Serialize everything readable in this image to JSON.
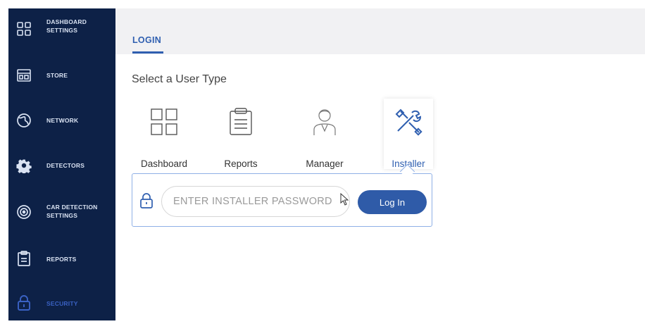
{
  "sidebar": {
    "items": [
      {
        "label": "DASHBOARD SETTINGS",
        "line1": "DASHBOARD",
        "line2": "SETTINGS",
        "icon": "dashboard-grid-icon"
      },
      {
        "label": "STORE",
        "icon": "store-icon"
      },
      {
        "label": "NETWORK",
        "icon": "globe-icon"
      },
      {
        "label": "DETECTORS",
        "icon": "gear-icon"
      },
      {
        "label": "CAR DETECTION SETTINGS",
        "line1": "CAR DETECTION",
        "line2": "SETTINGS",
        "icon": "radar-icon"
      },
      {
        "label": "REPORTS",
        "icon": "clipboard-icon"
      },
      {
        "label": "SECURITY",
        "icon": "lock-icon",
        "active": true
      }
    ]
  },
  "header": {
    "tab": "LOGIN"
  },
  "main": {
    "heading": "Select a User Type",
    "user_types": [
      {
        "label": "Dashboard",
        "icon": "dashboard-grid-icon"
      },
      {
        "label": "Reports",
        "icon": "clipboard-icon"
      },
      {
        "label": "Manager",
        "icon": "manager-icon"
      },
      {
        "label": "Installer",
        "icon": "tools-icon",
        "selected": true
      }
    ],
    "login": {
      "placeholder": "ENTER INSTALLER PASSWORD",
      "button": "Log In"
    }
  },
  "colors": {
    "sidebar_bg": "#0d2147",
    "accent": "#2f5fb0",
    "button": "#2f5ba8"
  }
}
